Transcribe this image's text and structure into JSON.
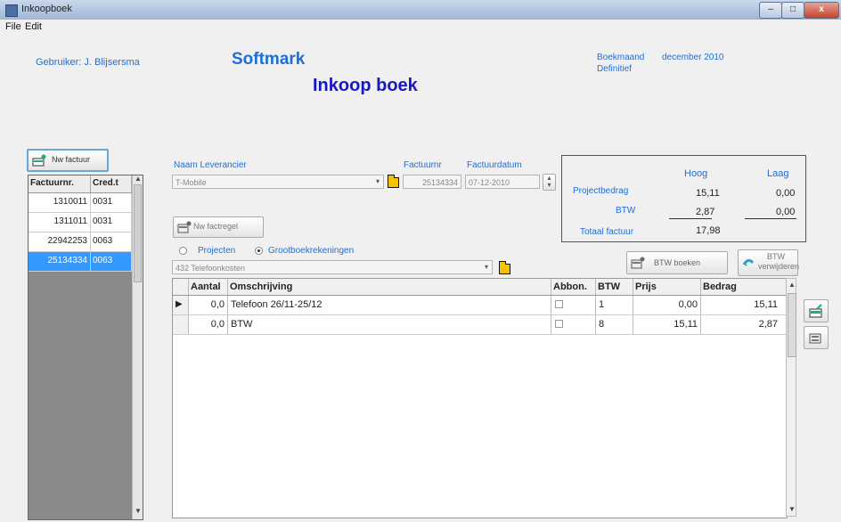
{
  "window": {
    "title": "Inkoopboek",
    "min": "–",
    "max": "□",
    "close": "x"
  },
  "menu": {
    "file": "File",
    "edit": "Edit"
  },
  "header": {
    "user": "Gebruiker: J. Blijsersma",
    "company": "Softmark",
    "page_title": "Inkoop boek",
    "period_label": "Boekmaand",
    "period_value": "december 2010",
    "status": "Definitief"
  },
  "left": {
    "new_invoice_button": "Nw factuur",
    "columns": [
      "Factuurnr.",
      "Cred.t"
    ],
    "rows": [
      {
        "factuurnr": "1310011",
        "cred": "0031",
        "selected": false
      },
      {
        "factuurnr": "1311011",
        "cred": "0031",
        "selected": false
      },
      {
        "factuurnr": "22942253",
        "cred": "0063",
        "selected": false
      },
      {
        "factuurnr": "25134334",
        "cred": "0063",
        "selected": true
      }
    ]
  },
  "form": {
    "supplier_label": "Naam Leverancier",
    "supplier_value": "T-Mobile",
    "invoice_no_label": "Factuurnr",
    "invoice_no_value": "25134334",
    "invoice_date_label": "Factuurdatum",
    "invoice_date_value": "07-12-2010",
    "new_line_button": "Nw factregel",
    "radio_projects": "Projecten",
    "radio_ledger": "Grootboekrekeningen",
    "ledger_value": "432 Telefoonkosten"
  },
  "totals": {
    "col_high": "Hoog",
    "col_low": "Laag",
    "project_label": "Projectbedrag",
    "project_high": "15,11",
    "project_low": "0,00",
    "btw_label": "BTW",
    "btw_high": "2,87",
    "btw_low": "0,00",
    "total_label": "Totaal factuur",
    "total_value": "17,98"
  },
  "actions": {
    "btw_book": "BTW boeken",
    "btw_remove_1": "BTW",
    "btw_remove_2": "verwijderen"
  },
  "grid": {
    "columns": [
      "Aantal",
      "Omschrijving",
      "Abbon.",
      "BTW",
      "Prijs",
      "Bedrag"
    ],
    "rows": [
      {
        "aantal": "0,0",
        "omschrijving": "Telefoon 26/11-25/12",
        "btw": "1",
        "prijs": "0,00",
        "bedrag": "15,11",
        "current": true
      },
      {
        "aantal": "0,0",
        "omschrijving": "BTW",
        "btw": "8",
        "prijs": "15,11",
        "bedrag": "2,87",
        "current": false
      }
    ]
  },
  "colors": {
    "accent": "#1f6ed8",
    "title": "#1717c8",
    "selection": "#3399ff",
    "folder": "#f5c400"
  },
  "icons": [
    "app-icon",
    "new-invoice-icon",
    "new-line-icon",
    "folder-icon",
    "btw-book-icon",
    "btw-remove-icon",
    "side-edit-icon",
    "side-calc-icon",
    "row-pointer-icon"
  ]
}
